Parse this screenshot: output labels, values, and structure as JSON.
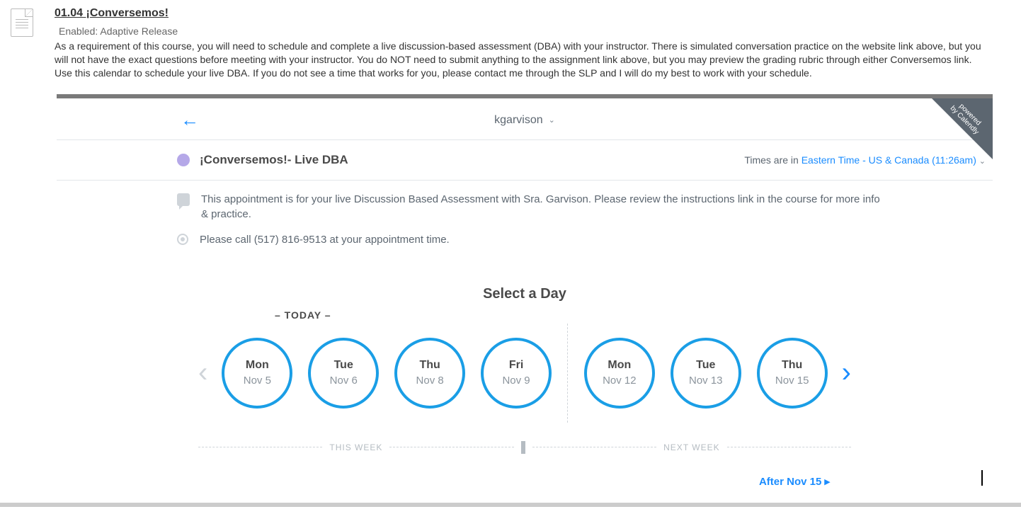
{
  "assignment": {
    "title": "01.04 ¡Conversemos!",
    "subtitle": "Enabled:   Adaptive Release",
    "desc1": "As a requirement of this course, you will need to schedule and complete a live discussion-based assessment (DBA) with your instructor. There is simulated conversation practice on the website link above, but you will not have the exact questions before meeting with your instructor. You do NOT need to submit anything to the assignment link above, but you may preview the grading rubric through either Conversemos link.",
    "desc2": "Use this calendar to schedule your live DBA. If you do not see a time that works for you, please contact me through the SLP and I will do my best to work with your schedule."
  },
  "calendly": {
    "host": "kgarvison",
    "ribbon_l1": "powered",
    "ribbon_l2": "by Calendly",
    "event_title": "¡Conversemos!- Live DBA",
    "tz_prefix": "Times are in ",
    "tz_link": "Eastern Time - US & Canada (11:26am)",
    "info1": "This appointment is for your live Discussion Based Assessment with Sra. Garvison. Please review the instructions link in the course for more info & practice.",
    "info2": "Please call (517) 816-9513 at your appointment time.",
    "select_day": "Select a Day",
    "today_label": "– TODAY –",
    "days": [
      {
        "dw": "Mon",
        "dt": "Nov 5"
      },
      {
        "dw": "Tue",
        "dt": "Nov 6"
      },
      {
        "dw": "Thu",
        "dt": "Nov 8"
      },
      {
        "dw": "Fri",
        "dt": "Nov 9"
      },
      {
        "dw": "Mon",
        "dt": "Nov 12"
      },
      {
        "dw": "Tue",
        "dt": "Nov 13"
      },
      {
        "dw": "Thu",
        "dt": "Nov 15"
      }
    ],
    "this_week": "THIS WEEK",
    "next_week": "NEXT WEEK",
    "after_link": "After Nov 15  ▸"
  }
}
